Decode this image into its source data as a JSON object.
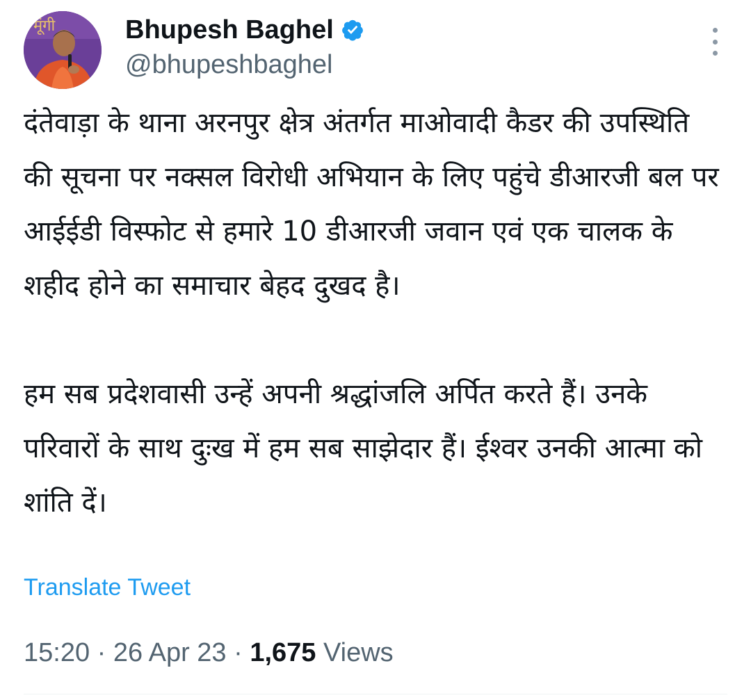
{
  "user": {
    "display_name": "Bhupesh Baghel",
    "handle": "@bhupeshbaghel",
    "verified": true,
    "avatar_icon": "profile-photo",
    "avatar_text": "मूंगी"
  },
  "tweet": {
    "paragraphs": [
      "दंतेवाड़ा के थाना अरनपुर क्षेत्र अंतर्गत माओवादी कैडर की उपस्थिति की सूचना पर नक्सल विरोधी अभियान के लिए पहुंचे डीआरजी बल पर आईईडी विस्फोट से हमारे 10 डीआरजी जवान एवं एक चालक के शहीद होने का समाचार बेहद दुखद है।",
      "हम सब प्रदेशवासी उन्हें अपनी श्रद्धांजलि अर्पित करते हैं। उनके परिवारों के साथ दुःख में हम सब साझेदार हैं। ईश्वर उनकी आत्मा को शांति दें।"
    ],
    "translate_label": "Translate Tweet",
    "time": "15:20",
    "separator": " · ",
    "date": "26 Apr 23",
    "views_count": "1,675",
    "views_label": "Views"
  },
  "colors": {
    "link": "#1d9bf0",
    "secondary_text": "#536471",
    "verified_badge": "#1d9bf0"
  }
}
